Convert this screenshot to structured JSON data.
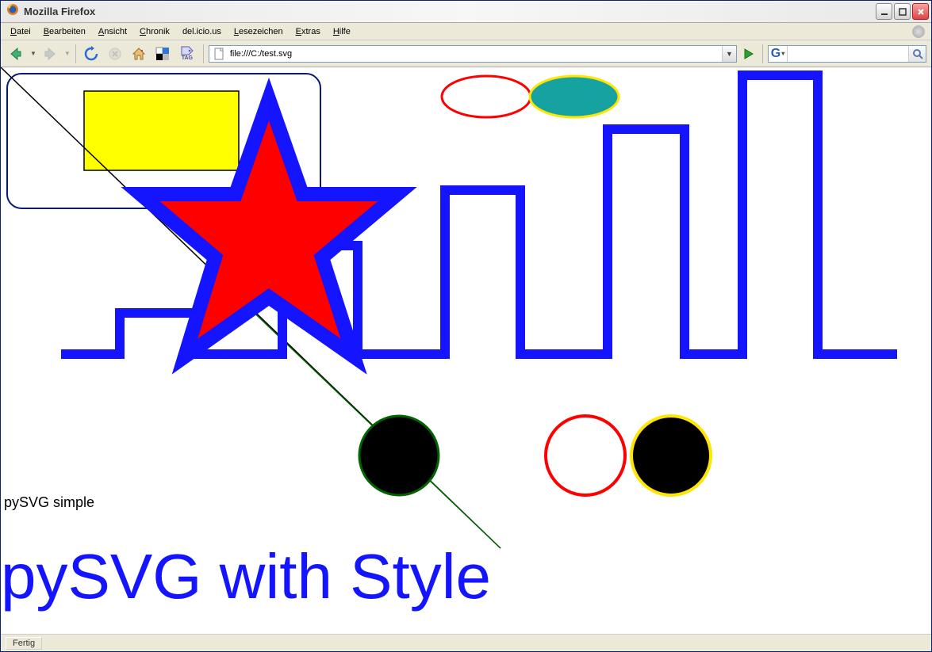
{
  "window": {
    "title": "Mozilla Firefox"
  },
  "menu": {
    "datei": "Datei",
    "bearbeiten": "Bearbeiten",
    "ansicht": "Ansicht",
    "chronik": "Chronik",
    "delicious": "del.icio.us",
    "lesezeichen": "Lesezeichen",
    "extras": "Extras",
    "hilfe": "Hilfe"
  },
  "toolbar": {
    "address_value": "file:///C:/test.svg",
    "tag_label": "TAG",
    "search_placeholder": ""
  },
  "svg": {
    "text_simple": "pySVG simple",
    "text_styled": "pySVG with Style",
    "colors": {
      "blue": "#1414ff",
      "yellow": "#ffff00",
      "teal": "#17a2a2",
      "red": "#ff0000",
      "green": "#006400"
    }
  },
  "status": {
    "text": "Fertig"
  }
}
